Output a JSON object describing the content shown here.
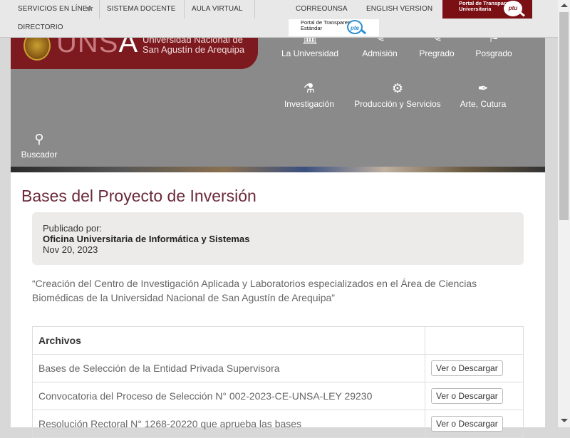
{
  "topbar": {
    "servicios": "SERVICIOS EN LÍNEA",
    "sistema_docente": "SISTEMA DOCENTE",
    "aula_virtual": "AULA VIRTUAL",
    "correo": "CORREOUNSA",
    "english": "ENGLISH VERSION",
    "directorio": "DIRECTORIO",
    "ptu_text": "Portal de Transparencia Universitaria",
    "ptu_logo": "ptu",
    "pte_text": "Portal de Transparencia Estándar",
    "pte_logo": "pte"
  },
  "brand": {
    "logo_text": "UNS",
    "logo_accent": "A",
    "name_line1": "Universidad Nacional de",
    "name_line2": "San Agustín de Arequipa"
  },
  "nav": [
    {
      "label": "La Universidad",
      "icon": "university-icon"
    },
    {
      "label": "Admisión",
      "icon": "edit-icon"
    },
    {
      "label": "Pregrado",
      "icon": "pencil-square-icon"
    },
    {
      "label": "Posgrado",
      "icon": "graduation-icon"
    },
    {
      "label": "Investigación",
      "icon": "flask-icon"
    },
    {
      "label": "Producción y Servicios",
      "icon": "gears-icon"
    },
    {
      "label": "Arte, Cutura",
      "icon": "paintbrush-icon"
    },
    {
      "label": "Buscador",
      "icon": "search-icon"
    }
  ],
  "page": {
    "title": "Bases del Proyecto de Inversión",
    "published_label": "Publicado por:",
    "published_by": "Oficina Universitaria de Informática y Sistemas",
    "published_date": "Nov 20, 2023",
    "description": "“Creación del Centro de Investigación Aplicada y Laboratorios especializados en el Área de Ciencias Biomédicas de la Universidad Nacional de San Agustín de Arequipa”"
  },
  "files_table": {
    "header": "Archivos",
    "rows": [
      {
        "name": "Bases de Selección de la Entidad Privada Supervisora",
        "action": "Ver o Descargar"
      },
      {
        "name": "Convocatoria del Proceso de Selección N° 002-2023-CE-UNSA-LEY 29230",
        "action": "Ver o Descargar"
      },
      {
        "name": "Resolución Rectoral N° 1268-20220 que aprueba las bases",
        "action": "Ver o Descargar"
      }
    ]
  },
  "colors": {
    "brand_maroon": "#7d1a1f",
    "header_gray": "#8a8a8a",
    "title_color": "#6b2a3a"
  }
}
